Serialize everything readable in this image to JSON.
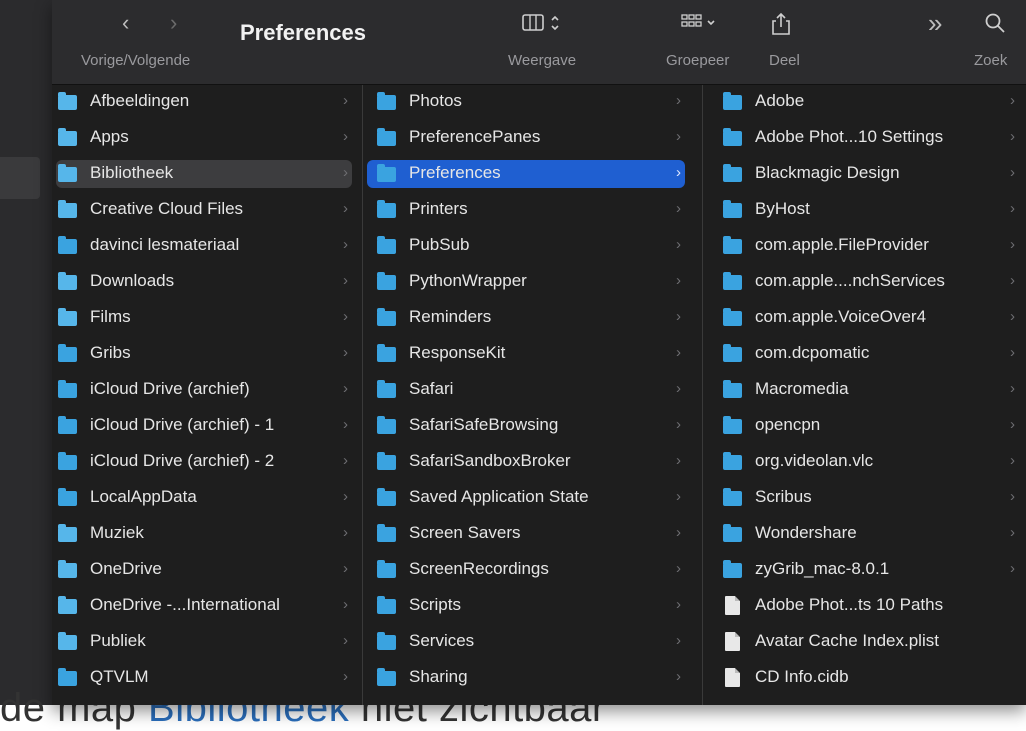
{
  "toolbar": {
    "title": "Preferences",
    "nav_label": "Vorige/Volgende",
    "view_label": "Weergave",
    "group_label": "Groepeer",
    "share_label": "Deel",
    "search_label": "Zoek",
    "back_glyph": "‹",
    "forward_glyph": "›",
    "more_glyph": "»"
  },
  "col1": [
    {
      "label": "Afbeeldingen",
      "icon": "pictures-folder-icon"
    },
    {
      "label": "Apps",
      "icon": "apps-folder-icon"
    },
    {
      "label": "Bibliotheek",
      "icon": "library-folder-icon",
      "selected": true
    },
    {
      "label": "Creative Cloud Files",
      "icon": "creative-cloud-folder-icon"
    },
    {
      "label": "davinci lesmateriaal",
      "icon": "folder-icon"
    },
    {
      "label": "Downloads",
      "icon": "downloads-folder-icon"
    },
    {
      "label": "Films",
      "icon": "movies-folder-icon"
    },
    {
      "label": "Gribs",
      "icon": "folder-icon"
    },
    {
      "label": "iCloud Drive (archief)",
      "icon": "folder-icon"
    },
    {
      "label": "iCloud Drive (archief) - 1",
      "icon": "folder-icon"
    },
    {
      "label": "iCloud Drive (archief) - 2",
      "icon": "folder-icon"
    },
    {
      "label": "LocalAppData",
      "icon": "folder-icon"
    },
    {
      "label": "Muziek",
      "icon": "music-folder-icon"
    },
    {
      "label": "OneDrive",
      "icon": "alias-folder-icon"
    },
    {
      "label": "OneDrive -...International",
      "icon": "cloud-folder-icon"
    },
    {
      "label": "Publiek",
      "icon": "public-folder-icon"
    },
    {
      "label": "QTVLM",
      "icon": "folder-icon"
    }
  ],
  "col2": [
    {
      "label": "Photos"
    },
    {
      "label": "PreferencePanes"
    },
    {
      "label": "Preferences",
      "selected": true
    },
    {
      "label": "Printers"
    },
    {
      "label": "PubSub"
    },
    {
      "label": "PythonWrapper"
    },
    {
      "label": "Reminders"
    },
    {
      "label": "ResponseKit"
    },
    {
      "label": "Safari"
    },
    {
      "label": "SafariSafeBrowsing"
    },
    {
      "label": "SafariSandboxBroker"
    },
    {
      "label": "Saved Application State"
    },
    {
      "label": "Screen Savers"
    },
    {
      "label": "ScreenRecordings"
    },
    {
      "label": "Scripts"
    },
    {
      "label": "Services"
    },
    {
      "label": "Sharing"
    }
  ],
  "col3": [
    {
      "label": "Adobe",
      "type": "folder"
    },
    {
      "label": "Adobe Phot...10 Settings",
      "type": "folder"
    },
    {
      "label": "Blackmagic Design",
      "type": "folder"
    },
    {
      "label": "ByHost",
      "type": "folder"
    },
    {
      "label": "com.apple.FileProvider",
      "type": "folder"
    },
    {
      "label": "com.apple....nchServices",
      "type": "folder"
    },
    {
      "label": "com.apple.VoiceOver4",
      "type": "folder"
    },
    {
      "label": "com.dcpomatic",
      "type": "folder"
    },
    {
      "label": "Macromedia",
      "type": "folder"
    },
    {
      "label": "opencpn",
      "type": "folder"
    },
    {
      "label": "org.videolan.vlc",
      "type": "folder"
    },
    {
      "label": "Scribus",
      "type": "folder"
    },
    {
      "label": "Wondershare",
      "type": "folder"
    },
    {
      "label": "zyGrib_mac-8.0.1",
      "type": "folder"
    },
    {
      "label": "Adobe Phot...ts 10 Paths",
      "type": "file"
    },
    {
      "label": "Avatar Cache Index.plist",
      "type": "file"
    },
    {
      "label": "CD Info.cidb",
      "type": "file"
    }
  ],
  "bg_text": {
    "prefix": "de map ",
    "link": "Bibliotheek",
    "suffix": " niet zichtbaar"
  },
  "colors": {
    "selection_blue": "#1f5fd1",
    "folder_blue": "#3aa3e0"
  }
}
